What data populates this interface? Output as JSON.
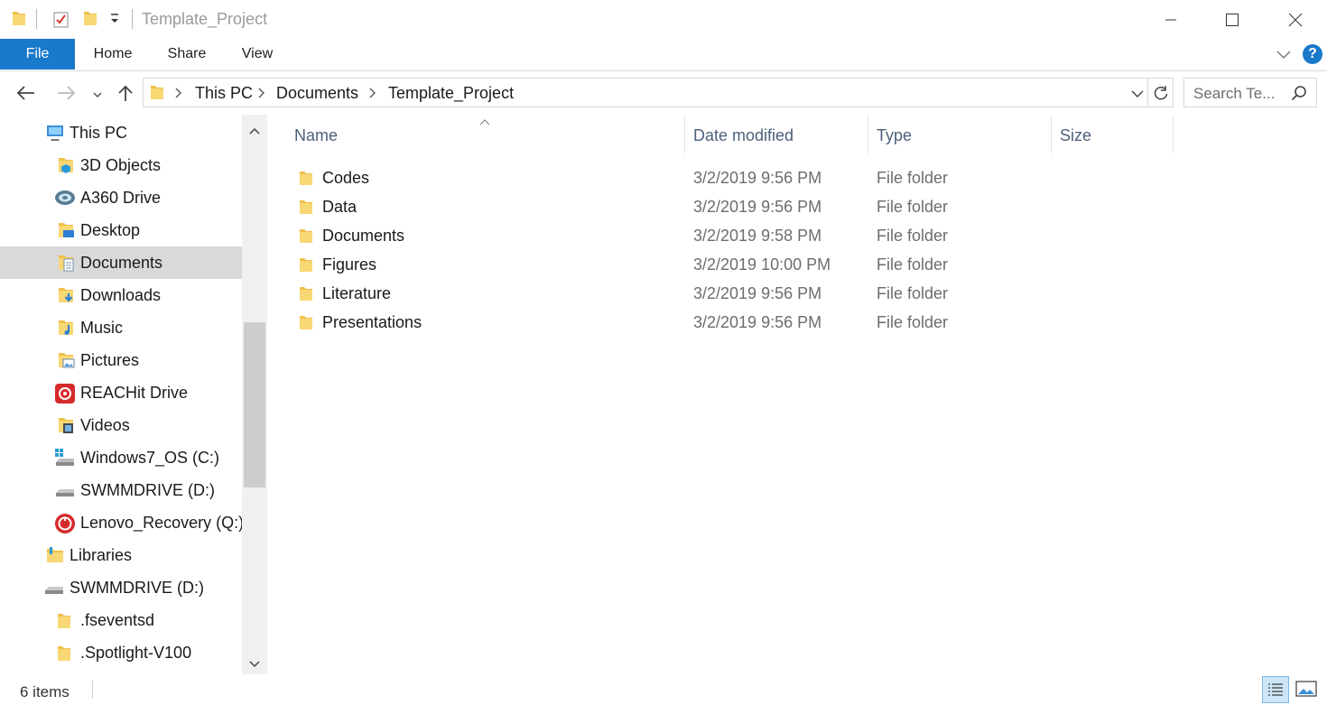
{
  "window": {
    "title": "Template_Project"
  },
  "ribbon": {
    "tabs": [
      "File",
      "Home",
      "Share",
      "View"
    ],
    "help_label": "?"
  },
  "address": {
    "breadcrumbs": [
      "This PC",
      "Documents",
      "Template_Project"
    ]
  },
  "search": {
    "placeholder": "Search Te..."
  },
  "nav": {
    "items": [
      {
        "label": "This PC",
        "icon": "computer-icon"
      },
      {
        "label": "3D Objects",
        "icon": "3d-objects-folder-icon"
      },
      {
        "label": "A360 Drive",
        "icon": "a360-drive-icon"
      },
      {
        "label": "Desktop",
        "icon": "desktop-folder-icon"
      },
      {
        "label": "Documents",
        "icon": "documents-folder-icon"
      },
      {
        "label": "Downloads",
        "icon": "downloads-folder-icon"
      },
      {
        "label": "Music",
        "icon": "music-folder-icon"
      },
      {
        "label": "Pictures",
        "icon": "pictures-folder-icon"
      },
      {
        "label": "REACHit Drive",
        "icon": "reachit-drive-icon"
      },
      {
        "label": "Videos",
        "icon": "videos-folder-icon"
      },
      {
        "label": "Windows7_OS (C:)",
        "icon": "windows-drive-icon"
      },
      {
        "label": "SWMMDRIVE (D:)",
        "icon": "drive-icon"
      },
      {
        "label": "Lenovo_Recovery (Q:)",
        "icon": "recovery-drive-icon"
      },
      {
        "label": "Libraries",
        "icon": "libraries-icon"
      },
      {
        "label": "SWMMDRIVE (D:)",
        "icon": "drive-icon"
      },
      {
        "label": ".fseventsd",
        "icon": "folder-icon"
      },
      {
        "label": ".Spotlight-V100",
        "icon": "folder-icon"
      }
    ],
    "selected": "Documents"
  },
  "columns": {
    "name": "Name",
    "date": "Date modified",
    "type": "Type",
    "size": "Size"
  },
  "files": [
    {
      "name": "Codes",
      "date": "3/2/2019 9:56 PM",
      "type": "File folder"
    },
    {
      "name": "Data",
      "date": "3/2/2019 9:56 PM",
      "type": "File folder"
    },
    {
      "name": "Documents",
      "date": "3/2/2019 9:58 PM",
      "type": "File folder"
    },
    {
      "name": "Figures",
      "date": "3/2/2019 10:00 PM",
      "type": "File folder"
    },
    {
      "name": "Literature",
      "date": "3/2/2019 9:56 PM",
      "type": "File folder"
    },
    {
      "name": "Presentations",
      "date": "3/2/2019 9:56 PM",
      "type": "File folder"
    }
  ],
  "status": {
    "item_count": "6 items"
  },
  "colors": {
    "accent": "#1979ca",
    "folder_yellow": "#f8d775",
    "selected_bg": "#d9d9d9"
  }
}
